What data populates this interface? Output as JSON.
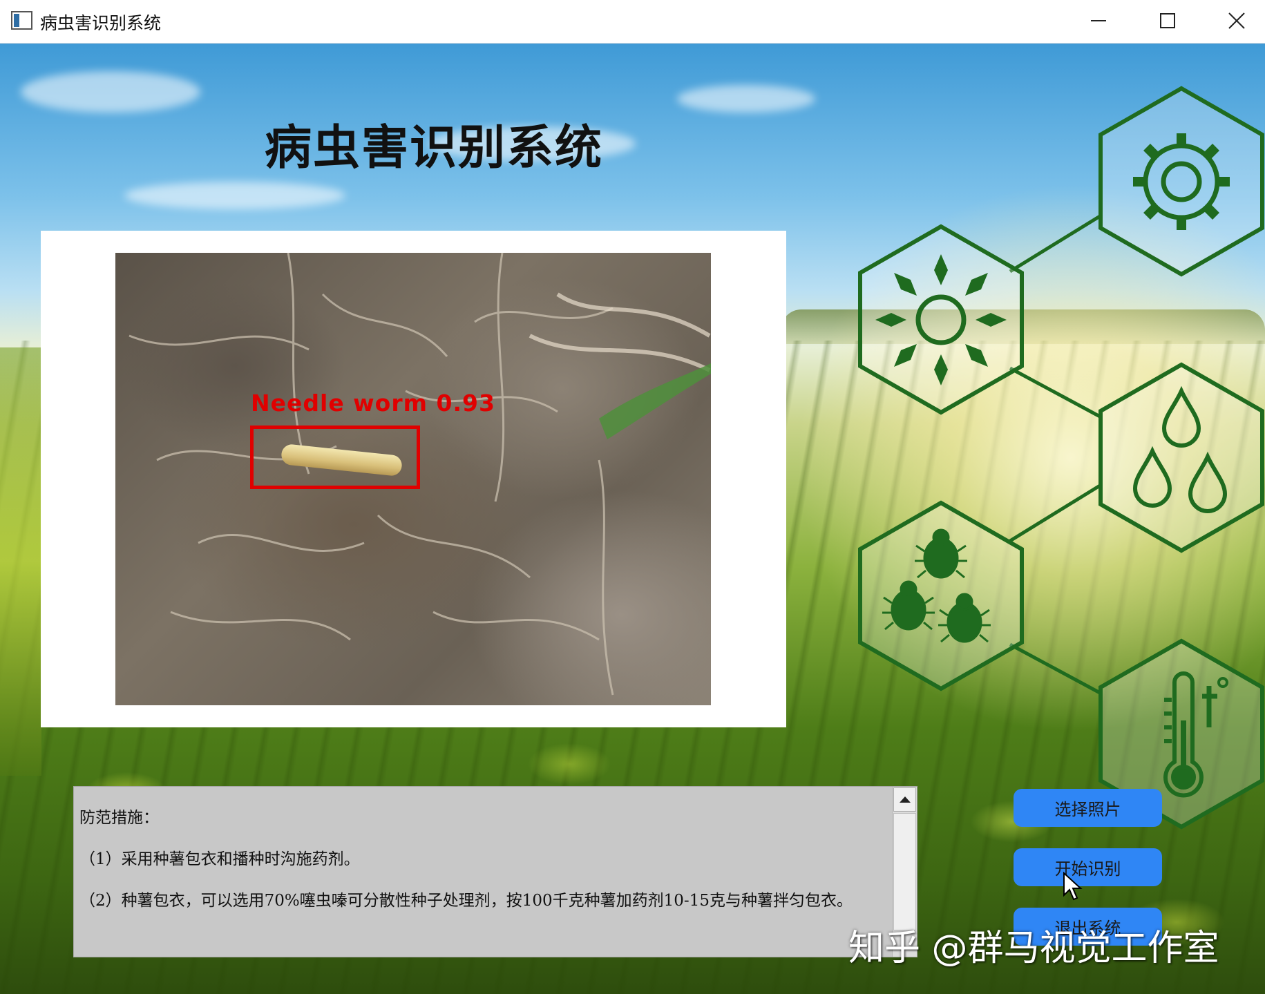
{
  "window": {
    "title": "病虫害识别系统"
  },
  "header": {
    "title": "病虫害识别系统"
  },
  "image_panel": {
    "detection": {
      "label": "Needle worm 0.93",
      "color": "#e00000"
    }
  },
  "measures": {
    "heading": "防范措施：",
    "items": [
      "（1）采用种薯包衣和播种时沟施药剂。",
      "（2）种薯包衣，可以选用70%噻虫嗪可分散性种子处理剂，按100千克种薯加药剂10-15克与种薯拌匀包衣。"
    ]
  },
  "buttons": {
    "select_photo": "选择照片",
    "start_recognition": "开始识别",
    "exit": "退出系统"
  },
  "watermark": {
    "text": "知乎 @群马视觉工作室"
  },
  "icons": {
    "hexagons": [
      "gear-icon",
      "sun-icon",
      "water-drops-icon",
      "bugs-icon",
      "thermometer-icon"
    ],
    "hex_color": "#1f6b1f"
  },
  "colors": {
    "button": "#2f86f5",
    "text_area_bg": "#c8c8c8"
  }
}
